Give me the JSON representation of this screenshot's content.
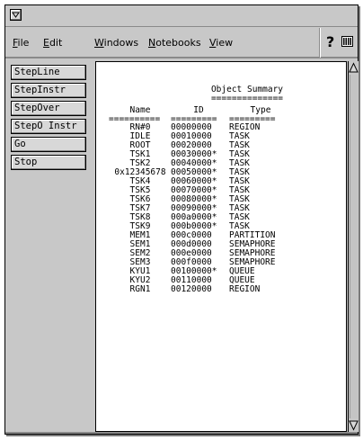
{
  "menubar": {
    "items": [
      {
        "mnemonic": "F",
        "rest": "ile"
      },
      {
        "mnemonic": "E",
        "rest": "dit"
      },
      {
        "mnemonic": "W",
        "rest": "indows"
      },
      {
        "mnemonic": "N",
        "rest": "otebooks"
      },
      {
        "mnemonic": "V",
        "rest": "iew"
      }
    ],
    "help_label": "?"
  },
  "buttons": [
    "StepLine",
    "StepInstr",
    "StepOver",
    "StepO Instr",
    "Go",
    "Stop"
  ],
  "summary": {
    "title": "Object Summary",
    "title_rule": "==============",
    "headers": {
      "name": "Name",
      "id": "ID",
      "type": "Type"
    },
    "rules": {
      "name": "==========",
      "id": "=========",
      "type": "========="
    },
    "rows": [
      {
        "name": "RN#0",
        "id": "00000000",
        "type": "REGION"
      },
      {
        "name": "IDLE",
        "id": "00010000",
        "type": "TASK"
      },
      {
        "name": "ROOT",
        "id": "00020000",
        "type": "TASK"
      },
      {
        "name": "TSK1",
        "id": "00030000*",
        "type": "TASK"
      },
      {
        "name": "TSK2",
        "id": "00040000*",
        "type": "TASK"
      },
      {
        "name": "0x12345678",
        "id": "00050000*",
        "type": "TASK"
      },
      {
        "name": "TSK4",
        "id": "00060000*",
        "type": "TASK"
      },
      {
        "name": "TSK5",
        "id": "00070000*",
        "type": "TASK"
      },
      {
        "name": "TSK6",
        "id": "00080000*",
        "type": "TASK"
      },
      {
        "name": "TSK7",
        "id": "00090000*",
        "type": "TASK"
      },
      {
        "name": "TSK8",
        "id": "000a0000*",
        "type": "TASK"
      },
      {
        "name": "TSK9",
        "id": "000b0000*",
        "type": "TASK"
      },
      {
        "name": "MEM1",
        "id": "000c0000",
        "type": "PARTITION"
      },
      {
        "name": "SEM1",
        "id": "000d0000",
        "type": "SEMAPHORE"
      },
      {
        "name": "SEM2",
        "id": "000e0000",
        "type": "SEMAPHORE"
      },
      {
        "name": "SEM3",
        "id": "000f0000",
        "type": "SEMAPHORE"
      },
      {
        "name": "KYU1",
        "id": "00100000*",
        "type": "QUEUE"
      },
      {
        "name": "KYU2",
        "id": "00110000",
        "type": "QUEUE"
      },
      {
        "name": "RGN1",
        "id": "00120000",
        "type": "REGION"
      }
    ]
  },
  "icons": {
    "window_menu": "window-menu-icon",
    "help": "help-icon",
    "status_gauge": "gauge-icon",
    "scroll_up": "scroll-up-arrow-icon",
    "scroll_down": "scroll-down-arrow-icon"
  }
}
